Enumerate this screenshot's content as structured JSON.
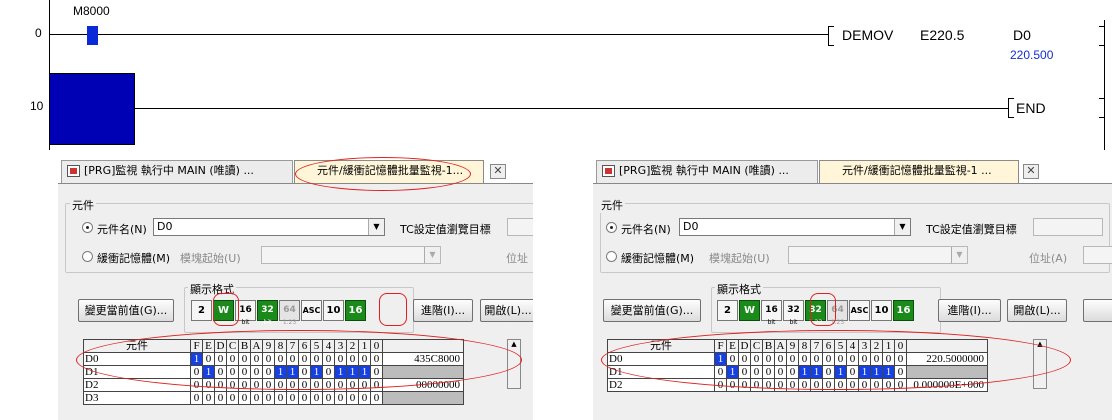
{
  "ladder": {
    "rungs": [
      {
        "step": "0",
        "contact": "M8000",
        "instruction": "DEMOV",
        "operand1": "E220.5",
        "operand2": "D0",
        "current_value": "220.500"
      },
      {
        "step": "10",
        "instruction": "END"
      }
    ]
  },
  "panels": [
    {
      "tabs": [
        "[PRG]監視 執行中 MAIN (唯讀) ...",
        "元件/緩衝記憶體批量監視-1..."
      ],
      "close": "✕",
      "group_title": "元件",
      "device_radio": "元件名(N)",
      "device_value": "D0",
      "tc_label": "TC設定值瀏覽目標",
      "buffer_radio": "緩衝記憶體(M)",
      "module_label": "模塊起始(U)",
      "address_label": "位址",
      "format_title": "顯示格式",
      "change_button": "變更當前值(G)...",
      "format_buttons": [
        "2",
        "W",
        "16",
        "32",
        "64",
        "ASC",
        "10",
        "16"
      ],
      "advanced_button": "進階(I)...",
      "open_button": "開啟(L)...",
      "col_header": "元件",
      "bit_headers": [
        "F",
        "E",
        "D",
        "C",
        "B",
        "A",
        "9",
        "8",
        "7",
        "6",
        "5",
        "4",
        "3",
        "2",
        "1",
        "0"
      ],
      "rows": [
        {
          "name": "D0",
          "bits": "1000000000000000",
          "value": "435C8000"
        },
        {
          "name": "D1",
          "bits": "0100000110101110",
          "value": ""
        },
        {
          "name": "D2",
          "bits": "0000000000000000",
          "value": "00000000"
        },
        {
          "name": "D3",
          "bits": "0000000000000000",
          "value": ""
        }
      ]
    },
    {
      "tabs": [
        "[PRG]監視 執行中 MAIN (唯讀) ...",
        "元件/緩衝記憶體批量監視-1 ..."
      ],
      "close": "✕",
      "group_title": "元件",
      "device_radio": "元件名(N)",
      "device_value": "D0",
      "tc_label": "TC設定值瀏覽目標",
      "buffer_radio": "緩衝記憶體(M)",
      "module_label": "模塊起始(U)",
      "address_label": "位址(A)",
      "format_title": "顯示格式",
      "change_button": "變更當前值(G)...",
      "format_buttons": [
        "2",
        "W",
        "16",
        "32",
        "32",
        "64",
        "ASC",
        "10",
        "16"
      ],
      "advanced_button": "進階(I)...",
      "open_button": "開啟(L)...",
      "col_header": "元件",
      "bit_headers": [
        "F",
        "E",
        "D",
        "C",
        "B",
        "A",
        "9",
        "8",
        "7",
        "6",
        "5",
        "4",
        "3",
        "2",
        "1",
        "0"
      ],
      "rows": [
        {
          "name": "D0",
          "bits": "1000000000000000",
          "value": "220.5000000"
        },
        {
          "name": "D1",
          "bits": "0100000110101110",
          "value": ""
        },
        {
          "name": "D2",
          "bits": "0000000000000000",
          "value": "0.000000E+000"
        }
      ]
    }
  ],
  "colors": {
    "ladder_blue": "#0000b4",
    "bit_on": "#1640e0",
    "highlight": "#e02020",
    "green_button": "#1a8a1a"
  }
}
